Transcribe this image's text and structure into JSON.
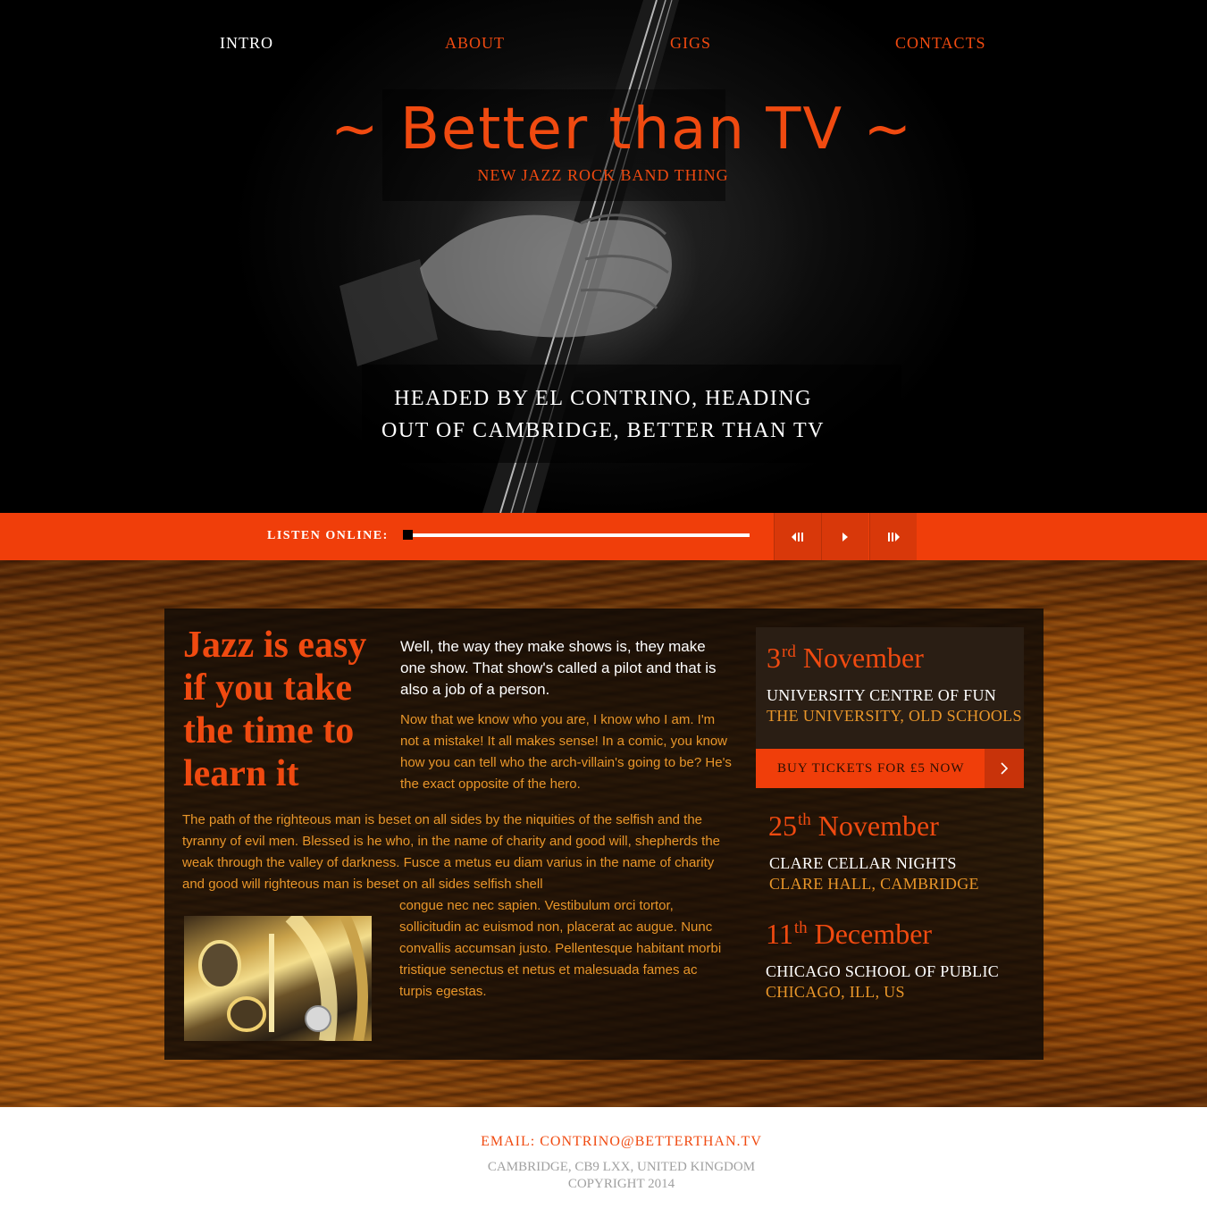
{
  "nav": {
    "items": [
      {
        "label": "INTRO",
        "active": true
      },
      {
        "label": "ABOUT",
        "active": false
      },
      {
        "label": "GIGS",
        "active": false
      },
      {
        "label": "CONTACTS",
        "active": false
      }
    ]
  },
  "hero": {
    "title": "~ Better than TV ~",
    "subtitle": "NEW JAZZ ROCK BAND THING",
    "tagline_line1": "HEADED BY EL CONTRINO, HEADING",
    "tagline_line2": "OUT OF CAMBRIDGE, BETTER THAN TV"
  },
  "player": {
    "label": "LISTEN ONLINE:",
    "progress": 0.0,
    "controls": [
      {
        "name": "previous",
        "glyph": "◂||"
      },
      {
        "name": "play",
        "glyph": "▸"
      },
      {
        "name": "next",
        "glyph": "||▸"
      }
    ]
  },
  "intro": {
    "headline": "Jazz is easy if you take the time to learn it",
    "lead": "Well, the way they make shows is, they make one show. That show's called a pilot and that is also a job of a person.",
    "body": "Now that we know who you are, I know who I am. I'm not a mistake! It all makes sense! In a comic, you know how you can tell who the arch-villain's going to be? He's the exact opposite of the hero.",
    "para_wide": "The path of the righteous man is beset on all sides by the  niquities of the selfish and the tyranny of evil men. Blessed is he who, in the name of charity and good will, shepherds the weak through the valley of darkness. Fusce a metus eu diam varius in the name of charity and good will righteous man is beset on all sides selfish shell",
    "para_side": "congue nec nec sapien. Vestibulum orci tortor, sollicitudin ac euismod non, placerat ac augue. Nunc convallis accumsan justo. Pellentesque habitant morbi tristique senectus et netus et malesuada fames ac turpis egestas."
  },
  "gigs": [
    {
      "day": "3",
      "suffix": "rd",
      "month": "November",
      "venue": "UNIVERSITY CENTRE OF FUN",
      "place": "THE UNIVERSITY, OLD SCHOOLS"
    },
    {
      "day": "25",
      "suffix": "th",
      "month": "November",
      "venue": "CLARE CELLAR NIGHTS",
      "place": "CLARE HALL, CAMBRIDGE"
    },
    {
      "day": "11",
      "suffix": "th",
      "month": "December",
      "venue": "CHICAGO SCHOOL OF PUBLIC",
      "place": "CHICAGO, ILL, US"
    }
  ],
  "buy_button": {
    "label": "BUY TICKETS FOR £5 NOW"
  },
  "footer": {
    "email": "EMAIL: CONTRINO@BETTERTHAN.TV",
    "address": "CAMBRIDGE, CB9 LXX, UNITED KINGDOM",
    "copyright": "COPYRIGHT 2014"
  },
  "colors": {
    "accent": "#f03e0a",
    "gold": "#e8962a",
    "dark": "#0e0a06"
  }
}
